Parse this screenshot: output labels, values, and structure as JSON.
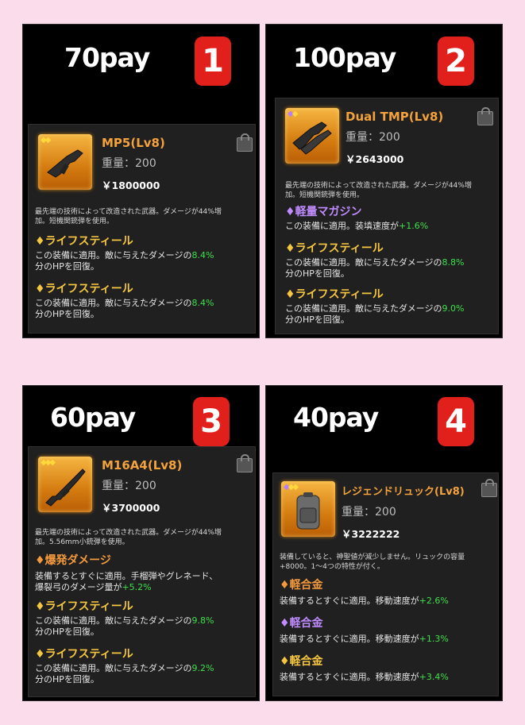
{
  "panels": [
    {
      "price": "70pay",
      "number": "1",
      "item": {
        "name": "MP5(Lv8)",
        "weight": "重量：200",
        "money": "￥1800000",
        "desc": [
          "最先端の技術によって改造された武器。ダメージが44%増",
          "加。短機関銃弾を使用。"
        ],
        "traits": [
          {
            "title": "ライフスティール",
            "line1": "この装備に適用。敵に与えたダメージの",
            "value": "8.4%",
            "line2": "分のHPを回復。"
          },
          {
            "title": "ライフスティール",
            "line1": "この装備に適用。敵に与えたダメージの",
            "value": "8.4%",
            "line2": "分のHPを回復。"
          }
        ]
      }
    },
    {
      "price": "100pay",
      "number": "2",
      "item": {
        "name": "Dual TMP(Lv8)",
        "weight": "重量：200",
        "money": "￥2643000",
        "desc": [
          "最先端の技術によって改造された武器。ダメージが44%増",
          "加。短機関銃弾を使用。"
        ],
        "traits": [
          {
            "title": "軽量マガジン",
            "line1": "この装備に適用。装填速度が",
            "value": "+1.6%",
            "line2": ""
          },
          {
            "title": "ライフスティール",
            "line1": "この装備に適用。敵に与えたダメージの",
            "value": "8.8%",
            "line2": "分のHPを回復。"
          },
          {
            "title": "ライフスティール",
            "line1": "この装備に適用。敵に与えたダメージの",
            "value": "9.0%",
            "line2": "分のHPを回復。"
          }
        ]
      }
    },
    {
      "price": "60pay",
      "number": "3",
      "item": {
        "name": "M16A4(Lv8)",
        "weight": "重量：200",
        "money": "￥3700000",
        "desc": [
          "最先端の技術によって改造された武器。ダメージが44%増",
          "加。5.56mm小銃弾を使用。"
        ],
        "traits": [
          {
            "title": "爆発ダメージ",
            "line1": "装備するとすぐに適用。手榴弾やグレネード、",
            "line2a": "爆裂弓のダメージ量が",
            "value": "+5.2%"
          },
          {
            "title": "ライフスティール",
            "line1": "この装備に適用。敵に与えたダメージの",
            "value": "9.8%",
            "line2": "分のHPを回復。"
          },
          {
            "title": "ライフスティール",
            "line1": "この装備に適用。敵に与えたダメージの",
            "value": "9.2%",
            "line2": "分のHPを回復。"
          }
        ]
      }
    },
    {
      "price": "40pay",
      "number": "4",
      "item": {
        "name": "レジェンドリュック(Lv8)",
        "weight": "重量：200",
        "money": "￥3222222",
        "desc": [
          "装備していると、神聖値が減少しません。リュックの容量",
          "+8000。1〜4つの特性が付く。"
        ],
        "traits": [
          {
            "title": "軽合金",
            "line1": "装備するとすぐに適用。移動速度が",
            "value": "+2.6%"
          },
          {
            "title": "軽合金",
            "line1": "装備するとすぐに適用。移動速度が",
            "value": "+1.3%"
          },
          {
            "title": "軽合金",
            "line1": "装備するとすぐに適用。移動速度が",
            "value": "+3.4%"
          }
        ]
      }
    }
  ],
  "colors": {
    "background": "#fadcea",
    "badge": "#e1201c",
    "item_name": "#f4a23c",
    "trait_gold": "#f6c640",
    "trait_purple": "#c08cff",
    "value_green": "#3ee04a"
  },
  "icons": [
    "lock-icon",
    "diamond-icon",
    "smg-icon",
    "rifle-icon",
    "backpack-icon"
  ]
}
